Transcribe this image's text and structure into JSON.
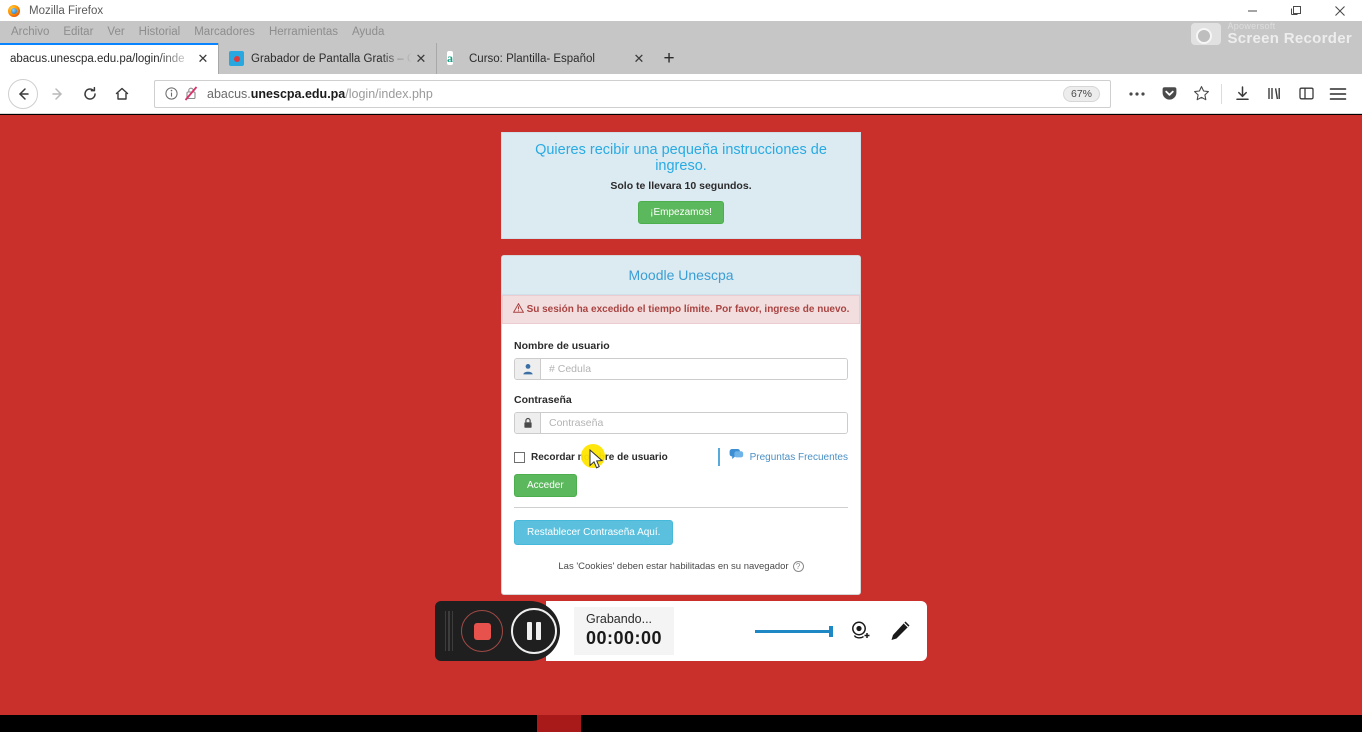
{
  "window": {
    "title": "Mozilla Firefox",
    "minimize": "minimize-button",
    "maximize": "maximize-button",
    "close": "close-button"
  },
  "menubar": {
    "items": [
      {
        "label": "Archivo"
      },
      {
        "label": "Editar"
      },
      {
        "label": "Ver"
      },
      {
        "label": "Historial"
      },
      {
        "label": "Marcadores"
      },
      {
        "label": "Herramientas"
      },
      {
        "label": "Ayuda"
      }
    ]
  },
  "tabs": [
    {
      "label": "abacus.unescpa.edu.pa/login/inde",
      "active": true,
      "favicon": "none"
    },
    {
      "label": "Grabador de Pantalla Gratis – C",
      "active": false,
      "favicon": "recorder-icon"
    },
    {
      "label": "Curso: Plantilla- Español",
      "active": false,
      "favicon": "moodle-icon"
    }
  ],
  "new_tab_label": "+",
  "toolbar": {
    "back_icon": "back-arrow-icon",
    "forward_icon": "forward-arrow-icon",
    "reload_icon": "reload-icon",
    "home_icon": "home-icon",
    "url_info_icon": "info-circle-icon",
    "url_insecure_icon": "crossed-lock-icon",
    "url_prefix": "abacus.",
    "url_domain": "unescpa.edu.pa",
    "url_path": "/login/index.php",
    "url_full": "abacus.unescpa.edu.pa/login/index.php",
    "zoom_level": "67%",
    "more_icon": "ellipsis-icon",
    "pocket_icon": "pocket-icon",
    "bookmark_icon": "star-icon",
    "downloads_icon": "download-icon",
    "library_icon": "library-icon",
    "sidebar_icon": "sidebar-icon",
    "menu_icon": "hamburger-menu-icon"
  },
  "watermark": {
    "brand_small": "Apowersoft",
    "brand_big": "Screen Recorder",
    "icon": "camera-icon"
  },
  "page": {
    "background_color": "#c9302c",
    "intro": {
      "title": "Quieres recibir una pequeña instrucciones de ingreso.",
      "subtitle": "Solo te llevara 10 segundos.",
      "button_label": "¡Empezamos!",
      "button_color": "#5cb85c",
      "title_color": "#29abe2",
      "panel_color": "#dceaf2"
    },
    "login": {
      "header": "Moodle Unescpa",
      "header_color": "#3a9fd4",
      "alert": {
        "icon": "warning-triangle-icon",
        "text": "Su sesión ha excedido el tiempo límite. Por favor, ingrese de nuevo.",
        "bg_color": "#f2dede",
        "text_color": "#a94442"
      },
      "username_label": "Nombre de usuario",
      "username_placeholder": "# Cedula",
      "username_value": "",
      "username_icon": "user-icon",
      "password_label": "Contraseña",
      "password_placeholder": "Contraseña",
      "password_value": "",
      "password_icon": "lock-icon",
      "remember_label": "Recordar nombre de usuario",
      "remember_checked": false,
      "faq_label": "Preguntas Frecuentes",
      "faq_icon": "chat-bubble-icon",
      "submit_label": "Acceder",
      "submit_color": "#5cb85c",
      "reset_label": "Restablecer Contraseña Aquí.",
      "reset_color": "#5bc0de",
      "cookies_note": "Las 'Cookies' deben estar habilitadas en su navegador",
      "cookies_help_icon": "help-circle-icon",
      "cookies_help_label": "?"
    }
  },
  "recorder": {
    "stop_icon": "stop-record-icon",
    "pause_icon": "pause-icon",
    "status_label": "Grabando...",
    "timer": "00:00:00",
    "volume_icon": "volume-slider",
    "webcam_icon": "webcam-add-icon",
    "pen_icon": "pencil-icon"
  },
  "cursor": {
    "highlight_color": "#ffe500",
    "icon": "mouse-pointer-icon"
  }
}
